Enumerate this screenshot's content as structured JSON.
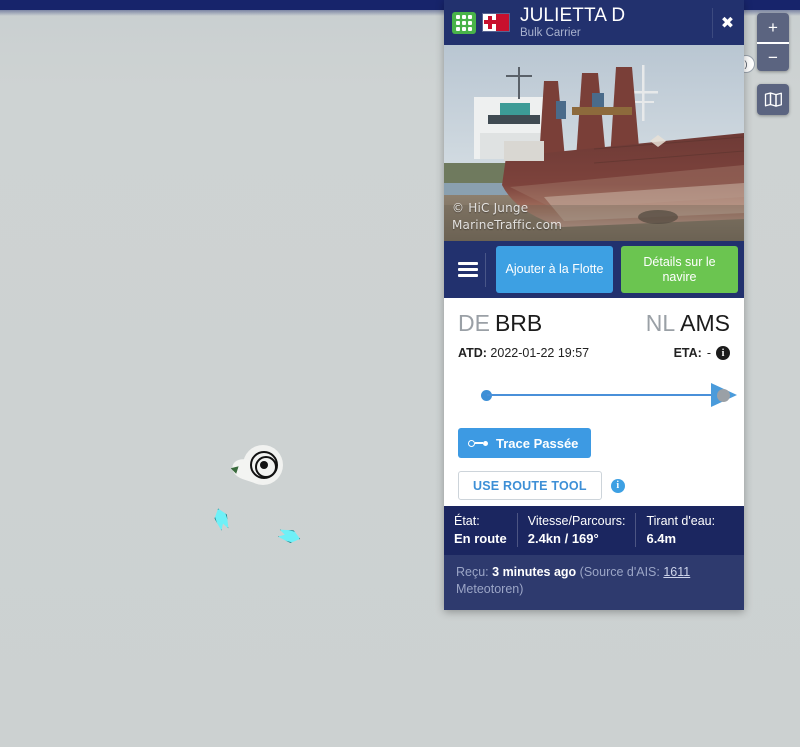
{
  "map": {
    "zoom_in_label": "+",
    "zoom_out_label": "−",
    "layers_icon": "map-layers-icon",
    "hidden_info_label": ")"
  },
  "panel": {
    "header": {
      "grid_icon": "grid-apps-icon",
      "flag": "malta-flag",
      "ship_name": "JULIETTA D",
      "ship_type": "Bulk Carrier",
      "close_label": "✖"
    },
    "photo": {
      "watermark_credit": "© HiC Junge",
      "watermark_site": "MarineTraffic.com"
    },
    "actions": {
      "menu_icon": "hamburger-menu-icon",
      "add_to_fleet": "Ajouter à la Flotte",
      "vessel_details": "Détails sur le navire"
    },
    "voyage": {
      "from_country": "DE",
      "from_port": "BRB",
      "to_country": "NL",
      "to_port": "AMS",
      "atd_label": "ATD:",
      "atd_value": "2022-01-22 19:57",
      "eta_label": "ETA:",
      "eta_value": "-",
      "eta_info_icon": "info-icon"
    },
    "tools": {
      "past_track": "Trace Passée",
      "route_tool": "USE ROUTE TOOL",
      "route_info_icon": "info-icon"
    },
    "stats": [
      {
        "label": "État:",
        "value": "En route"
      },
      {
        "label": "Vitesse/Parcours:",
        "value": "2.4kn / 169°"
      },
      {
        "label": "Tirant d'eau:",
        "value": "6.4m"
      }
    ],
    "received": {
      "prefix": "Reçu:",
      "time": "3 minutes ago",
      "source_open": "(Source d'AIS:",
      "source_link": "1611",
      "source_tail": "Meteotoren)"
    }
  },
  "colors": {
    "header_navy": "#22316e",
    "stats_navy": "#1b2660",
    "received_navy": "#2e3a6e",
    "accent_blue": "#3d9ae3",
    "accent_green": "#6bc550",
    "grid_green": "#49b349",
    "map_bg": "#ccd1d1",
    "vessel_cyan": "#6ff0f7"
  }
}
